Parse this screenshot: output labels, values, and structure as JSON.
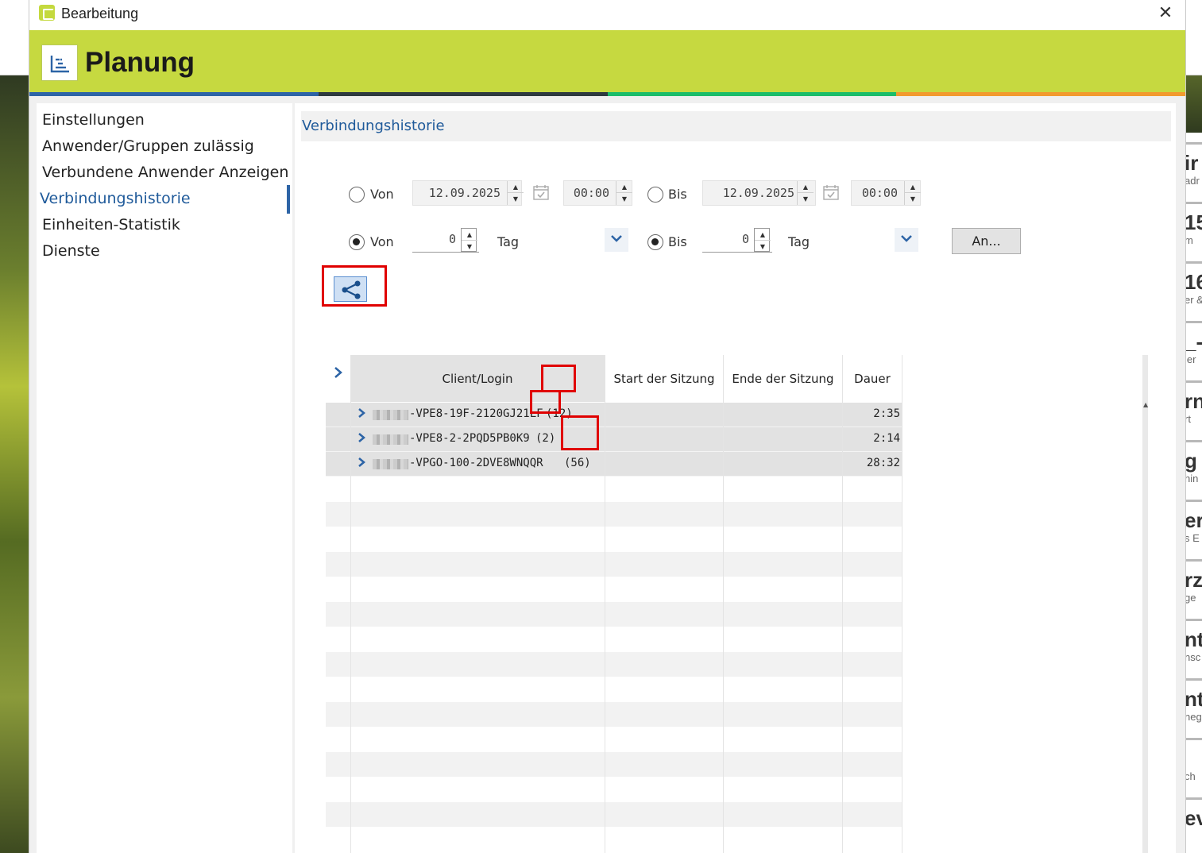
{
  "window": {
    "title": "Bearbeitung",
    "close_symbol": "✕"
  },
  "header": {
    "title": "Planung",
    "stripe_colors": [
      "#2d64a6",
      "#2e3a3f",
      "#1bbd6a",
      "#f29a2e"
    ],
    "accent_color": "#c6d940"
  },
  "nav": {
    "items": [
      {
        "label": "Einstellungen"
      },
      {
        "label": "Anwender/Gruppen zulässig"
      },
      {
        "label": "Verbundene Anwender Anzeigen"
      },
      {
        "label": "Verbindungshistorie",
        "active": true
      },
      {
        "label": "Einheiten-Statistik"
      },
      {
        "label": "Dienste"
      }
    ]
  },
  "section": {
    "title": "Verbindungshistorie"
  },
  "filter": {
    "row1": {
      "from_label": "Von",
      "from_date": "12.09.2025",
      "from_time": "00:00",
      "to_label": "Bis",
      "to_date": "12.09.2025",
      "to_time": "00:00",
      "selected": false
    },
    "row2": {
      "from_label": "Von",
      "from_value": "0",
      "from_unit": "Tag",
      "to_label": "Bis",
      "to_value": "0",
      "to_unit": "Tag",
      "selected": true
    },
    "apply_button": "An..."
  },
  "table": {
    "columns": [
      "Client/Login",
      "Start der Sitzung",
      "Ende der Sitzung",
      "Dauer"
    ],
    "rows": [
      {
        "client": "-VPE8-19F-2120GJ21LF",
        "count": "(12)",
        "start": "",
        "end": "",
        "dauer": "2:35"
      },
      {
        "client": "-VPE8-2-2PQD5PB0K9",
        "count": "(2)",
        "start": "",
        "end": "",
        "dauer": "2:14"
      },
      {
        "client": "-VPGO-100-2DVE8WNQQR",
        "count": "(56)",
        "start": "",
        "end": "",
        "dauer": "28:32"
      }
    ]
  },
  "background_app": {
    "tiles": [
      {
        "big": "ir",
        "small": "adr"
      },
      {
        "big": "15",
        "small": "m"
      },
      {
        "big": "16",
        "small": "er &"
      },
      {
        "big": "_-",
        "small": "ler"
      },
      {
        "big": "rn",
        "small": "rt"
      },
      {
        "big": "g",
        "small": "hin"
      },
      {
        "big": "er",
        "small": "s E"
      },
      {
        "big": "rz",
        "small": "ge"
      },
      {
        "big": "nt",
        "small": "nsc"
      },
      {
        "big": "nt",
        "small": "neg"
      },
      {
        "big": "",
        "small": "ch"
      },
      {
        "big": "ev",
        "small": ""
      }
    ]
  }
}
